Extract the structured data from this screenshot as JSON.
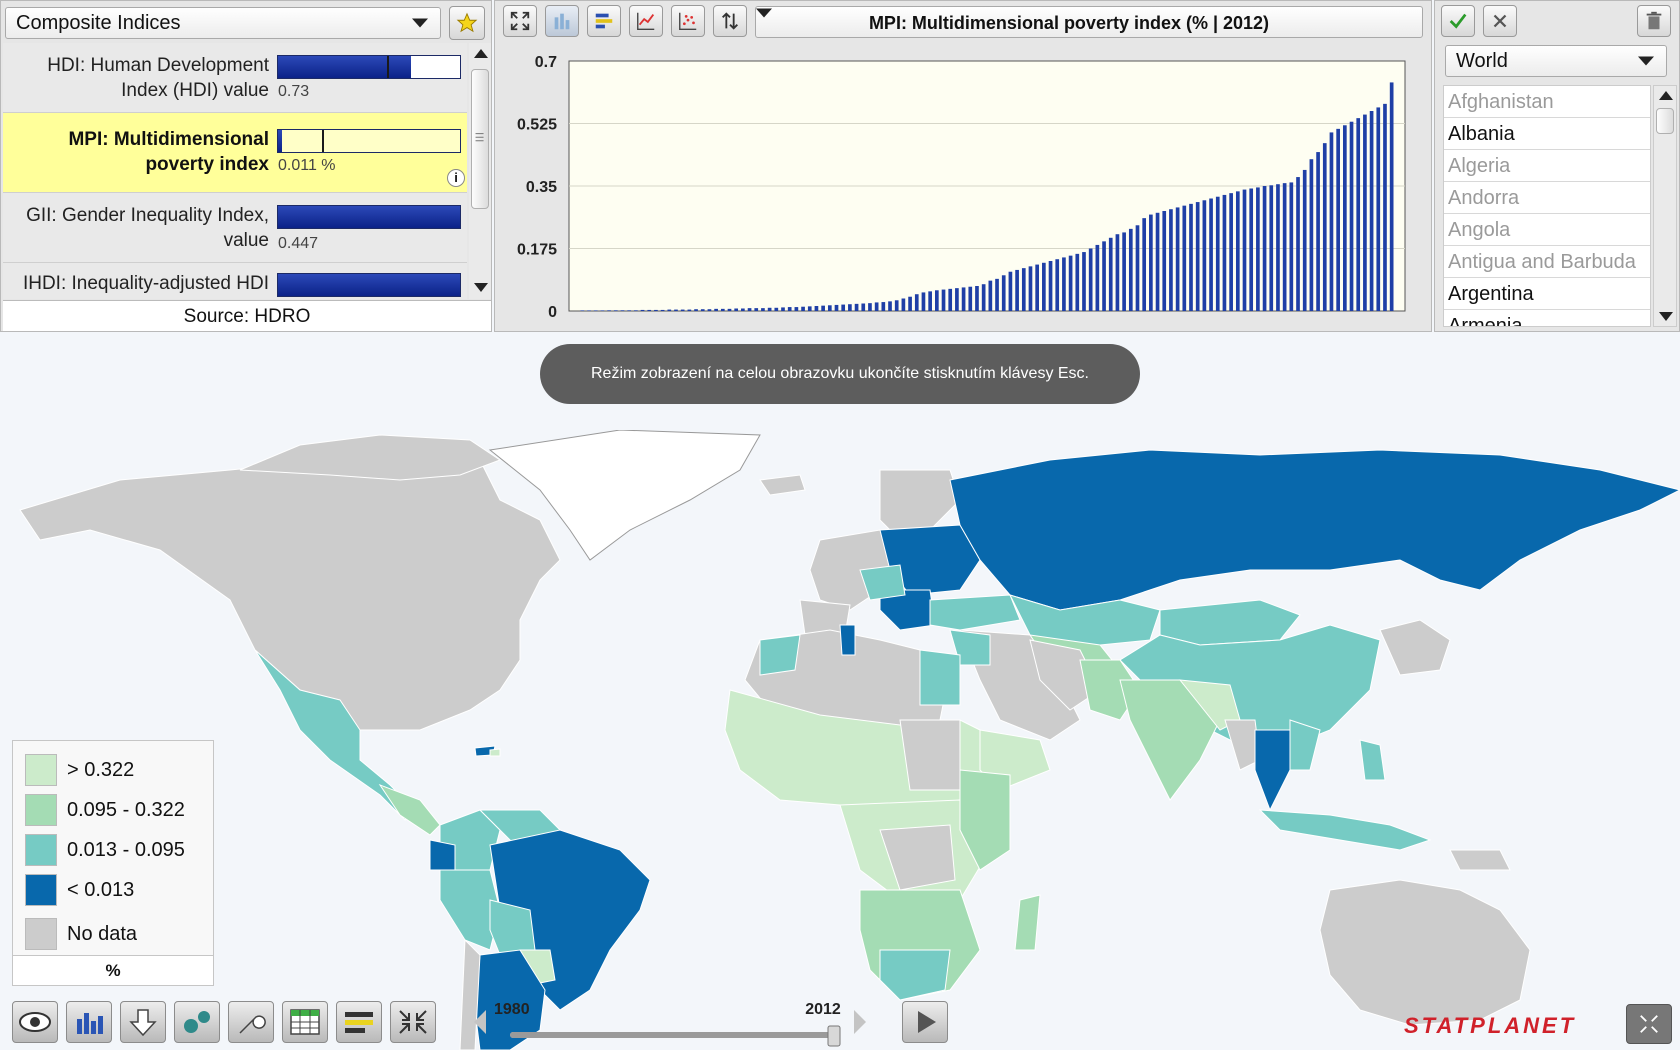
{
  "left_panel": {
    "category": "Composite Indices",
    "indicators": [
      {
        "name_line1": "HDI: Human Development",
        "name_line2": "Index (HDI) value",
        "value": "0.73",
        "bar_fraction": 0.73,
        "mark_fraction": 0.6
      },
      {
        "name_line1": "MPI: Multidimensional",
        "name_line2": "poverty index",
        "value": "0.011 %",
        "bar_fraction": 0.02,
        "mark_fraction": 0.24,
        "selected": true
      },
      {
        "name_line1": "GII: Gender Inequality Index,",
        "name_line2": "value",
        "value": "0.447",
        "bar_fraction": 1.0
      },
      {
        "name_line1": "IHDI: Inequality-adjusted HDI",
        "name_line2": "",
        "value": "",
        "bar_fraction": 1.0
      }
    ],
    "info_glyph": "i",
    "source": "Source: HDRO"
  },
  "chart": {
    "dropdown_label": "MPI: Multidimensional poverty index (% | 2012)",
    "toolbar_icons": [
      "fullscreen-icon",
      "bar-chart-icon",
      "horizontal-bar-icon",
      "line-chart-icon",
      "scatter-plot-icon",
      "sort-icon"
    ]
  },
  "chart_data": {
    "type": "bar",
    "title": "MPI: Multidimensional poverty index (% | 2012)",
    "xlabel": "",
    "ylabel": "",
    "ylim": [
      0,
      0.7
    ],
    "yticks": [
      "0",
      "0.175",
      "0.35",
      "0.525",
      "0.7"
    ],
    "bar_color": "#1f3fa6",
    "plot_background": "#fefef2",
    "values": [
      0.001,
      0.001,
      0.001,
      0.001,
      0.002,
      0.002,
      0.002,
      0.002,
      0.002,
      0.003,
      0.003,
      0.003,
      0.003,
      0.004,
      0.004,
      0.004,
      0.004,
      0.005,
      0.005,
      0.005,
      0.006,
      0.006,
      0.006,
      0.007,
      0.007,
      0.008,
      0.008,
      0.008,
      0.009,
      0.009,
      0.01,
      0.011,
      0.011,
      0.012,
      0.013,
      0.014,
      0.015,
      0.016,
      0.017,
      0.018,
      0.019,
      0.02,
      0.021,
      0.022,
      0.024,
      0.025,
      0.027,
      0.03,
      0.035,
      0.04,
      0.047,
      0.052,
      0.055,
      0.058,
      0.06,
      0.062,
      0.064,
      0.066,
      0.068,
      0.07,
      0.075,
      0.085,
      0.09,
      0.1,
      0.11,
      0.115,
      0.12,
      0.125,
      0.13,
      0.135,
      0.14,
      0.145,
      0.15,
      0.155,
      0.16,
      0.165,
      0.175,
      0.185,
      0.195,
      0.205,
      0.215,
      0.22,
      0.23,
      0.24,
      0.26,
      0.27,
      0.275,
      0.28,
      0.285,
      0.29,
      0.295,
      0.3,
      0.305,
      0.31,
      0.315,
      0.32,
      0.325,
      0.33,
      0.335,
      0.34,
      0.343,
      0.346,
      0.35,
      0.352,
      0.355,
      0.358,
      0.36,
      0.375,
      0.395,
      0.425,
      0.445,
      0.47,
      0.5,
      0.51,
      0.52,
      0.53,
      0.54,
      0.55,
      0.56,
      0.57,
      0.58,
      0.64
    ]
  },
  "country_panel": {
    "region": "World",
    "countries": [
      {
        "name": "Afghanistan",
        "dim": true
      },
      {
        "name": "Albania",
        "dim": false
      },
      {
        "name": "Algeria",
        "dim": true
      },
      {
        "name": "Andorra",
        "dim": true
      },
      {
        "name": "Angola",
        "dim": true
      },
      {
        "name": "Antigua and Barbuda",
        "dim": true
      },
      {
        "name": "Argentina",
        "dim": false
      },
      {
        "name": "Armenia",
        "dim": false
      }
    ]
  },
  "toast": "Režim zobrazení na celou obrazovku ukončíte stisknutím klávesy Esc.",
  "legend": {
    "items": [
      {
        "label": "> 0.322",
        "color": "#ccebcb"
      },
      {
        "label": "0.095 - 0.322",
        "color": "#a4dcb4"
      },
      {
        "label": "0.013 - 0.095",
        "color": "#76cbc4"
      },
      {
        "label": "< 0.013",
        "color": "#0868ac"
      },
      {
        "label": "No data",
        "color": "#cccccc"
      }
    ],
    "unit": "%"
  },
  "timeline": {
    "start": "1980",
    "end": "2012",
    "position_fraction": 1.0
  },
  "bottom_toolbar": [
    "eye-icon",
    "bar-chart-icon",
    "download-icon",
    "bubble-icon",
    "wrench-icon",
    "table-icon",
    "legend-icon",
    "minimize-icon"
  ],
  "logo": "STATPLANET"
}
